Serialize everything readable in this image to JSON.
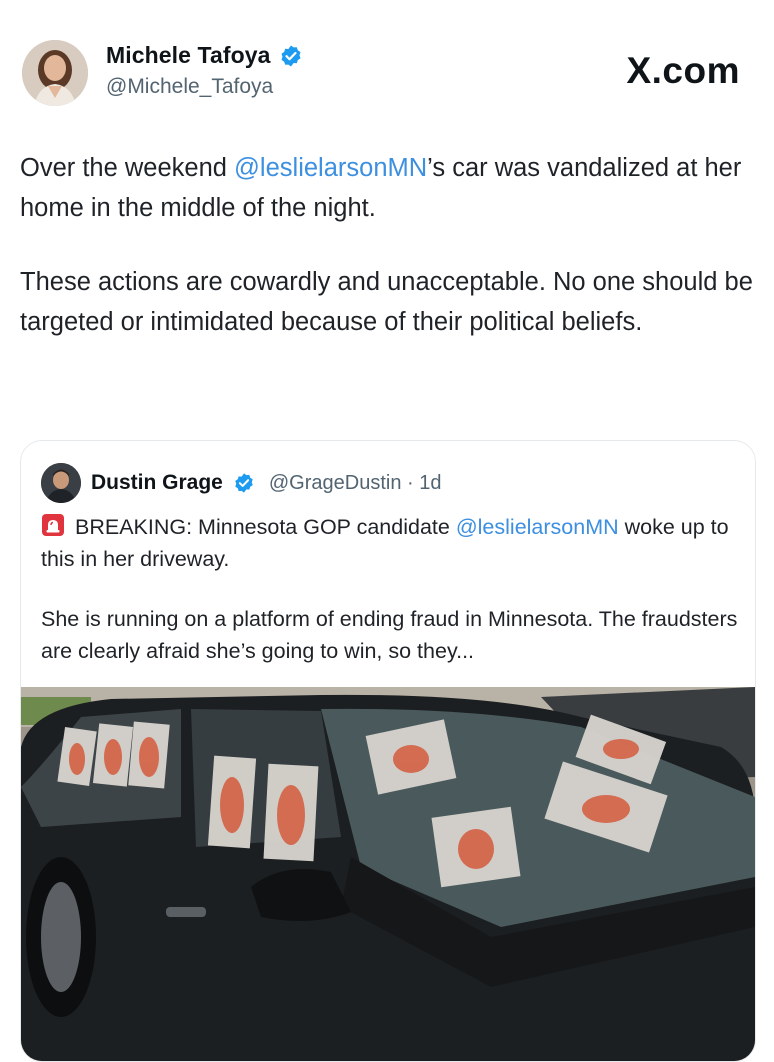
{
  "author": {
    "name": "Michele Tafoya",
    "handle": "@Michele_Tafoya",
    "verified": true
  },
  "brand": "X.com",
  "tweet": {
    "paragraph1_before": "Over the weekend ",
    "paragraph1_mention": "@leslielarsonMN",
    "paragraph1_after": "’s car was vandalized at her home in the middle of the night.",
    "paragraph2": "These actions are cowardly and unacceptable. No one should be targeted or intimidated because of their political beliefs."
  },
  "quote": {
    "name": "Dustin Grage",
    "handle": "@GrageDustin",
    "separator": "·",
    "time": "1d",
    "verified": true,
    "line1_before": "BREAKING: Minnesota GOP candidate ",
    "line1_mention": "@leslielarsonMN",
    "line1_after": " woke up to this in her driveway.",
    "paragraph2": "She is running on a platform of ending fraud in Minnesota. The fraudsters are clearly afraid she’s going to win, so they...",
    "icon": "siren-icon"
  },
  "colors": {
    "mention": "#3d8fe0",
    "verified": "#1d9bf0",
    "text": "#1f2328",
    "muted": "#536471",
    "siren": "#e0353f"
  },
  "photo": {
    "subject": "black-car-with-papers-on-windows"
  }
}
